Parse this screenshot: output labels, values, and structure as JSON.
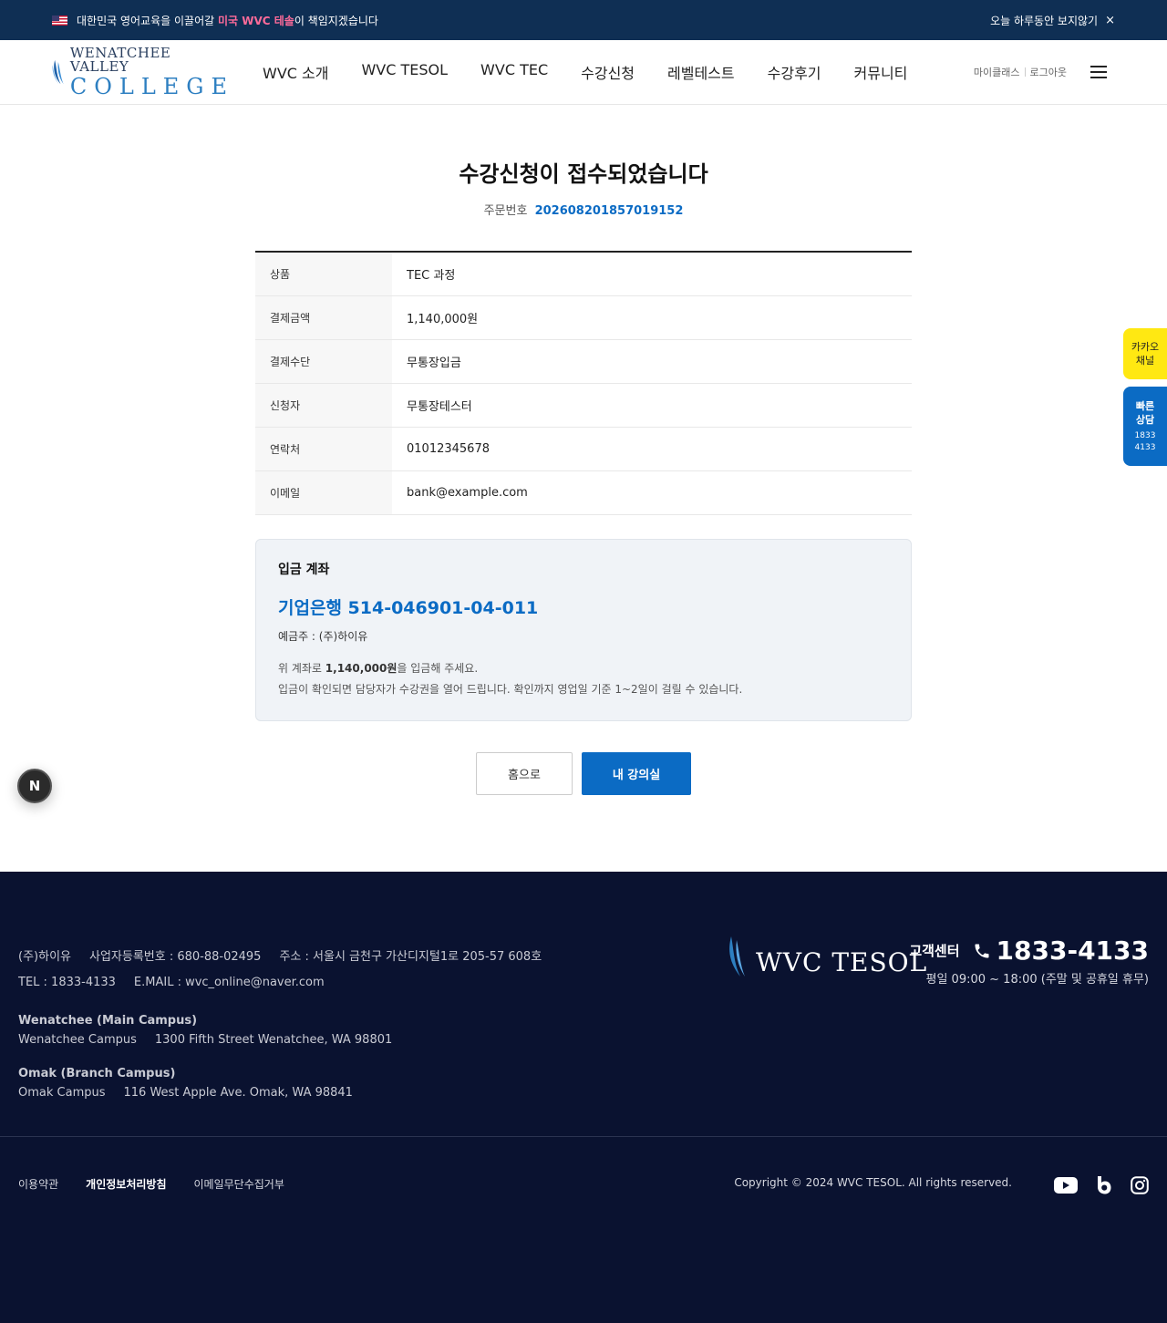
{
  "topbar": {
    "text_before": "대한민국 영어교육을 이끌어갈 ",
    "text_highlight": "미국 WVC 테솔",
    "text_after": "이 책임지겠습니다",
    "dismiss_label": "오늘 하루동안 보지않기",
    "close_symbol": "×"
  },
  "header": {
    "logo_top": "WENATCHEE VALLEY",
    "logo_bottom": "COLLEGE",
    "nav": [
      "WVC 소개",
      "WVC TESOL",
      "WVC TEC",
      "수강신청",
      "레벨테스트",
      "수강후기",
      "커뮤니티"
    ],
    "myclass": "마이클래스",
    "logout": "로그아웃"
  },
  "main": {
    "title": "수강신청이 접수되었습니다",
    "order_label": "주문번호",
    "order_number": "202608201857019152",
    "rows": [
      {
        "label": "상품",
        "value": "TEC 과정"
      },
      {
        "label": "결제금액",
        "value": "1,140,000원"
      },
      {
        "label": "결제수단",
        "value": "무통장입금"
      },
      {
        "label": "신청자",
        "value": "무통장테스터"
      },
      {
        "label": "연락처",
        "value": "01012345678"
      },
      {
        "label": "이메일",
        "value": "bank@example.com"
      }
    ],
    "account": {
      "title": "입금 계좌",
      "number": "기업은행 514-046901-04-011",
      "holder": "예금주 : (주)하이유",
      "note1_before": "위 계좌로 ",
      "note1_amount": "1,140,000원",
      "note1_after": "을 입금해 주세요.",
      "note2": "입금이 확인되면 담당자가 수강권을 열어 드립니다. 확인까지 영업일 기준 1~2일이 걸릴 수 있습니다."
    },
    "btn_home": "홈으로",
    "btn_class": "내 강의실"
  },
  "side": {
    "kakao_line1": "카카오",
    "kakao_line2": "채널",
    "consult_line1": "빠른",
    "consult_line2": "상담",
    "consult_num1": "1833",
    "consult_num2": "4133"
  },
  "next_badge": "N",
  "footer": {
    "company": "(주)하이유",
    "biz_no": "사업자등록번호 : 680-88-02495",
    "address": "주소 : 서울시 금천구 가산디지털1로 205-57 608호",
    "tel": "TEL : 1833-4133",
    "email": "E.MAIL : wvc_online@naver.com",
    "campus1_title": "Wenatchee (Main Campus)",
    "campus1_name": "Wenatchee Campus",
    "campus1_addr": "1300 Fifth Street Wenatchee, WA 98801",
    "campus2_title": "Omak (Branch Campus)",
    "campus2_name": "Omak Campus",
    "campus2_addr": "116 West Apple Ave. Omak, WA 98841",
    "logo_text": "WVC TESOL",
    "cs_label": "고객센터",
    "cs_phone": "1833-4133",
    "cs_hours": "평일 09:00 ~ 18:00 (주말 및 공휴일 휴무)",
    "links": [
      "이용약관",
      "개인정보처리방침",
      "이메일무단수집거부"
    ],
    "copyright": "Copyright © 2024 WVC TESOL. All rights reserved.",
    "social": [
      "youtube-icon",
      "blog-icon",
      "instagram-icon"
    ]
  },
  "colors": {
    "topbar_bg": "#0f2f54",
    "accent": "#0b6bc4",
    "highlight": "#ff6b9a",
    "kakao": "#ffe812",
    "footer_bg": "#0a1230"
  }
}
